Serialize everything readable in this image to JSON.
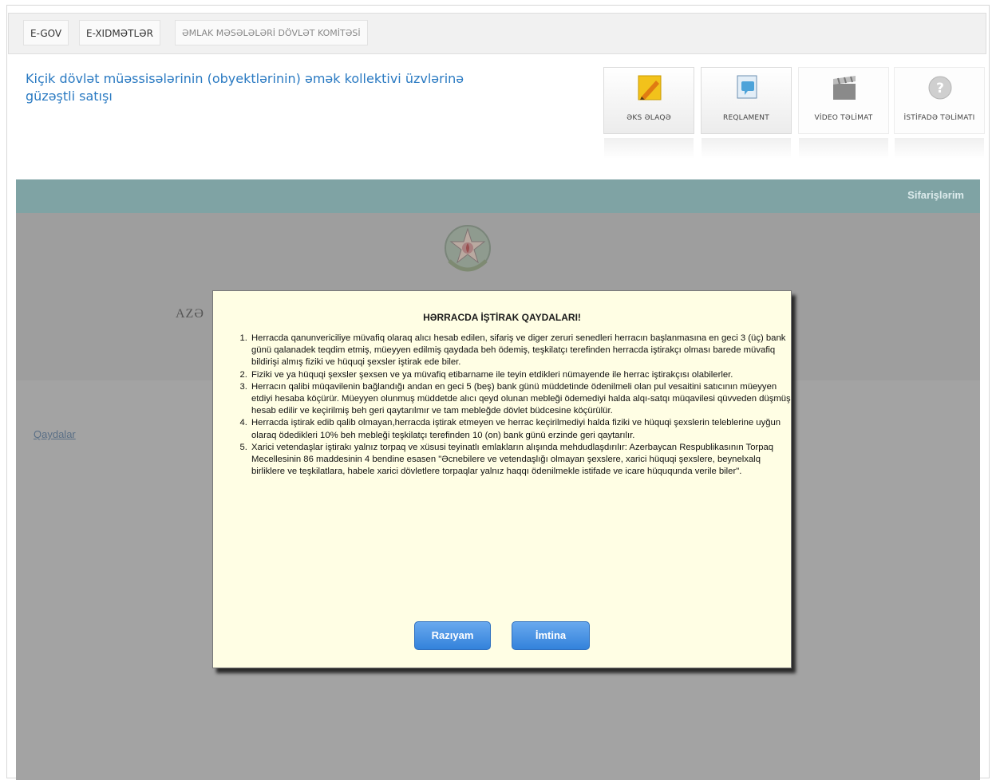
{
  "breadcrumb": [
    "E-GOV",
    "E-XIDMƏTLƏR",
    "ƏMLAK MƏSƏLƏLƏRİ DÖVLƏT KOMİTƏSİ"
  ],
  "page_title": "Kiçik dövlət müəssisələrinin (obyektlərinin) əmək kollektivi üzvlərinə güzəştli satışı",
  "toolbar": {
    "feedback": "ƏKS ƏLAQƏ",
    "regulation": "REQLAMENT",
    "video": "VİDEO TƏLİMAT",
    "usage": "İSTİFADƏ TƏLİMATI"
  },
  "nav": {
    "orders": "Sifarişlərim"
  },
  "background": {
    "heading_fragment": "AZƏ",
    "rules_link": "Qaydalar"
  },
  "modal": {
    "title": "HƏRRACDA İŞTİRAK QAYDALARI!",
    "rules": [
      "Herracda qanunvericiliye müvafiq olaraq alıcı hesab edilen, sifariş ve diger zeruri senedleri herracın başlanmasına en geci 3 (üç) bank günü qalanadek teqdim etmiş, müeyyen edilmiş qaydada beh ödemiş, teşkilatçı terefinden herracda iştirakçı olması barede müvafiq bildirişi almış fiziki ve hüquqi şexsler iştirak ede biler.",
      "Fiziki ve ya hüquqi şexsler şexsen ve ya müvafiq etibarname ile teyin etdikleri nümayende ile herrac iştirakçısı olabilerler.",
      "Herracın qalibi müqavilenin bağlandığı andan en geci 5 (beş) bank günü müddetinde ödenilmeli olan pul vesaitini satıcının müeyyen etdiyi hesaba köçürür. Müeyyen olunmuş müddetde alıcı qeyd olunan mebleği ödemediyi halda alqı-satqı müqavilesi qüvveden düşmüş hesab edilir ve keçirilmiş beh geri qaytarılmır ve tam mebleğde dövlet büdcesine köçürülür.",
      "Herracda iştirak edib qalib olmayan,herracda iştirak etmeyen ve herrac keçirilmediyi halda fiziki ve hüquqi şexslerin teleblerine uyğun olaraq ödedikleri 10% beh mebleği teşkilatçı terefinden 10 (on) bank günü erzinde geri qaytarılır.",
      "Xarici vetendaşlar iştirakı yalnız torpaq ve xüsusi teyinatlı emlakların alışında mehdudlaşdırılır: Azerbaycan Respublikasının Torpaq Mecellesinin 86 maddesinin 4 bendine esasen \"Əcnebilere ve vetendaşlığı olmayan şexslere, xarici hüquqi şexslere, beynelxalq birliklere ve teşkilatlara, habele xarici dövletlere torpaqlar yalnız haqqı ödenilmekle istifade ve icare hüququnda verile biler\"."
    ],
    "agree": "Razıyam",
    "refuse": "İmtina"
  }
}
